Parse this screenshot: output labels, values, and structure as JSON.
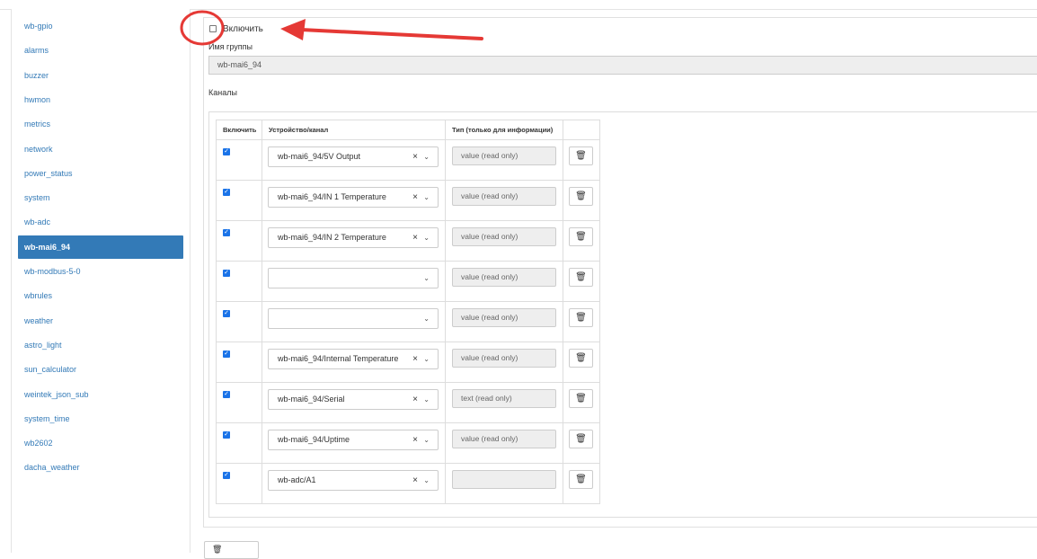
{
  "sidebar": {
    "items": [
      {
        "label": "wb-gpio"
      },
      {
        "label": "alarms"
      },
      {
        "label": "buzzer"
      },
      {
        "label": "hwmon"
      },
      {
        "label": "metrics"
      },
      {
        "label": "network"
      },
      {
        "label": "power_status"
      },
      {
        "label": "system"
      },
      {
        "label": "wb-adc"
      },
      {
        "label": "wb-mai6_94",
        "active": true
      },
      {
        "label": "wb-modbus-5-0"
      },
      {
        "label": "wbrules"
      },
      {
        "label": "weather"
      },
      {
        "label": "astro_light"
      },
      {
        "label": "sun_calculator"
      },
      {
        "label": "weintek_json_sub"
      },
      {
        "label": "system_time"
      },
      {
        "label": "wb2602"
      },
      {
        "label": "dacha_weather"
      }
    ]
  },
  "form": {
    "enable_label": "Включить",
    "enable_checked": false,
    "group_name_label": "Имя группы",
    "group_name_value": "wb-mai6_94",
    "channels_label": "Каналы"
  },
  "table": {
    "headers": {
      "enable": "Включить",
      "device": "Устройство/канал",
      "type": "Тип (только для информации)"
    },
    "rows": [
      {
        "checked": true,
        "device": "wb-mai6_94/5V Output",
        "clearable": true,
        "type": "value (read only)"
      },
      {
        "checked": true,
        "device": "wb-mai6_94/IN 1 Temperature",
        "clearable": true,
        "type": "value (read only)"
      },
      {
        "checked": true,
        "device": "wb-mai6_94/IN 2 Temperature",
        "clearable": true,
        "type": "value (read only)"
      },
      {
        "checked": true,
        "device": "",
        "clearable": false,
        "type": "value (read only)"
      },
      {
        "checked": true,
        "device": "",
        "clearable": false,
        "type": "value (read only)"
      },
      {
        "checked": true,
        "device": "wb-mai6_94/Internal Temperature",
        "clearable": true,
        "type": "value (read only)"
      },
      {
        "checked": true,
        "device": "wb-mai6_94/Serial",
        "clearable": true,
        "type": "text (read only)"
      },
      {
        "checked": true,
        "device": "wb-mai6_94/Uptime",
        "clearable": true,
        "type": "value (read only)"
      },
      {
        "checked": true,
        "device": "wb-adc/A1",
        "clearable": true,
        "type": ""
      }
    ]
  },
  "icons": {
    "clear": "×",
    "chevron": "⌄",
    "trash": "🗑",
    "check": "✓"
  },
  "colors": {
    "accent": "#337ab7",
    "checkbox": "#1a73e8",
    "annotation": "#e53935"
  }
}
